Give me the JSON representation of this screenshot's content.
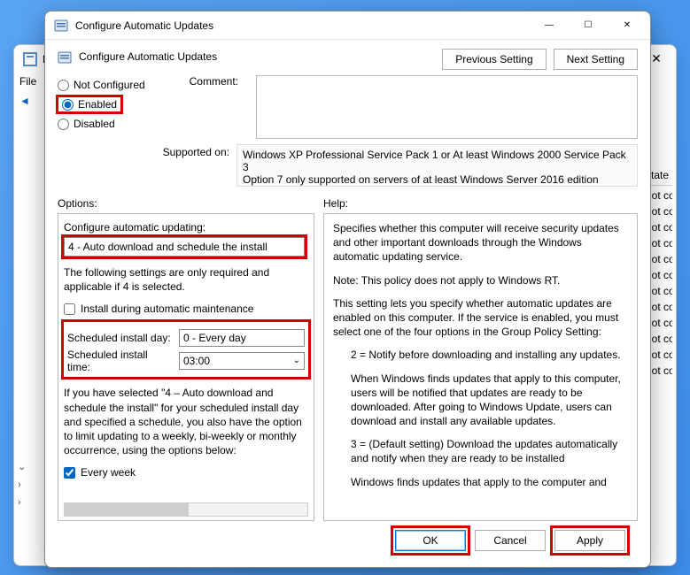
{
  "window": {
    "title": "Configure Automatic Updates",
    "subtitle": "Configure Automatic Updates"
  },
  "nav": {
    "previous": "Previous Setting",
    "next": "Next Setting"
  },
  "policy_state": {
    "not_configured": "Not Configured",
    "enabled": "Enabled",
    "disabled": "Disabled",
    "selected": "enabled"
  },
  "labels": {
    "comment": "Comment:",
    "supported_on": "Supported on:",
    "options": "Options:",
    "help": "Help:"
  },
  "supported_text": "Windows XP Professional Service Pack 1 or At least Windows 2000 Service Pack 3\nOption 7 only supported on servers of at least Windows Server 2016 edition",
  "options": {
    "configure_label": "Configure automatic updating:",
    "configure_value": "4 - Auto download and schedule the install",
    "following_note": "The following settings are only required and applicable if 4 is selected.",
    "install_maint": "Install during automatic maintenance",
    "install_maint_checked": false,
    "sched_day_label": "Scheduled install day:",
    "sched_day_value": "0 - Every day",
    "sched_time_label": "Scheduled install time:",
    "sched_time_value": "03:00",
    "limit_note": "If you have selected \"4 – Auto download and schedule the install\" for your scheduled install day and specified a schedule, you also have the option to limit updating to a weekly, bi-weekly or monthly occurrence, using the options below:",
    "every_week": "Every week",
    "every_week_checked": true
  },
  "help": {
    "p1": "Specifies whether this computer will receive security updates and other important downloads through the Windows automatic updating service.",
    "p2": "Note: This policy does not apply to Windows RT.",
    "p3": "This setting lets you specify whether automatic updates are enabled on this computer. If the service is enabled, you must select one of the four options in the Group Policy Setting:",
    "p4": "2 = Notify before downloading and installing any updates.",
    "p5": "When Windows finds updates that apply to this computer, users will be notified that updates are ready to be downloaded. After going to Windows Update, users can download and install any available updates.",
    "p6": "3 = (Default setting) Download the updates automatically and notify when they are ready to be installed",
    "p7": "Windows finds updates that apply to the computer and"
  },
  "buttons": {
    "ok": "OK",
    "cancel": "Cancel",
    "apply": "Apply"
  },
  "bg": {
    "file": "File",
    "state_hdr": "State",
    "row": "Not configured"
  }
}
